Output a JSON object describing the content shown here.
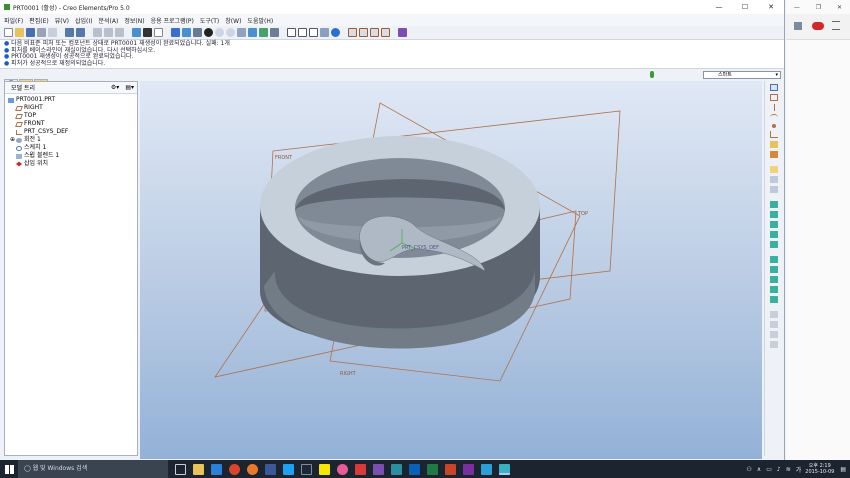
{
  "window": {
    "title": "PRT0001 (활성) - Creo Elements/Pro 5.0",
    "controls": [
      "—",
      "☐",
      "✕"
    ]
  },
  "menu": [
    "파일(F)",
    "편집(E)",
    "뷰(V)",
    "삽입(I)",
    "분석(A)",
    "정보(N)",
    "응용 프로그램(P)",
    "도구(T)",
    "창(W)",
    "도움말(H)"
  ],
  "messages": [
    "다음 비표준 피처 또는 컴포넌트 상태로 PRT0001 재생성이 완료되었습니다. 실패: 1개",
    "피처를 베이스라인이 재실이었습니다. 다시 선택하십시오.",
    "PRT0001 재생성이 성공적으로 완료되었습니다.",
    "피처가 성공적으로 재정의되었습니다."
  ],
  "filter": {
    "value": "스마트"
  },
  "model_tree": {
    "header": "모델 트리",
    "items": [
      "PRT0001.PRT",
      "RIGHT",
      "TOP",
      "FRONT",
      "PRT_CSYS_DEF",
      "회전 1",
      "스케치 1",
      "스윕 블렌드 1",
      "삽입 위치"
    ]
  },
  "viewport": {
    "datum_labels": [
      "FRONT",
      "TOP",
      "PRT_CSYS_DEF",
      "RIGHT"
    ]
  },
  "taskbar": {
    "search_placeholder": "웹 및 Windows 검색",
    "time": "오후 2:19",
    "date": "2015-10-09"
  },
  "colors": {
    "viewport_top": "#e0e8f5",
    "viewport_bottom": "#93b1d7",
    "model_surface": "#c6d0da",
    "model_shadow": "#5d6670",
    "datum": "#b0714a"
  }
}
